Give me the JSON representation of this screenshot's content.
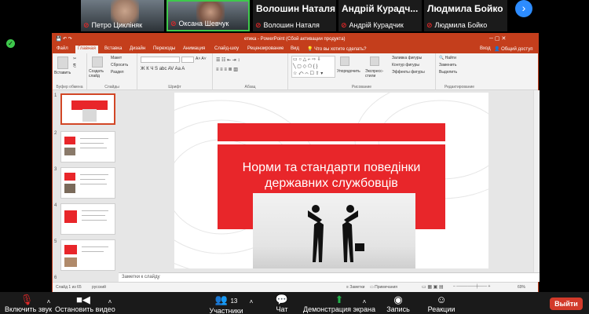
{
  "participants": [
    {
      "name": "Петро Цикліняк"
    },
    {
      "name": "Оксана Шевчук"
    },
    {
      "name": "Волошин Наталя",
      "caption": "Волошин Наталя"
    },
    {
      "name": "Андрій Курадч...",
      "caption": "Андрій Курадчик"
    },
    {
      "name": "Людмила Бойко",
      "caption": "Людмила Бойко"
    }
  ],
  "ppt": {
    "title": "етика - PowerPoint (Сбой активации продукта)",
    "search": "Что вы хотите сделать?",
    "account": "Вход",
    "share": "Общий доступ",
    "tabs": [
      "Файл",
      "Главная",
      "Вставка",
      "Дизайн",
      "Переходы",
      "Анимация",
      "Слайд-шоу",
      "Рецензирование",
      "Вид"
    ],
    "ribbon": {
      "paste": "Вставить",
      "clipboard": "Буфер обмена",
      "new_slide": "Создать слайд",
      "layout": "Макет",
      "reset": "Сбросить",
      "section": "Раздел",
      "slides": "Слайды",
      "font": "Шрифт",
      "paragraph": "Абзац",
      "arrange": "Упорядочить",
      "quick_styles": "Экспресс-стили",
      "fill": "Заливка фигуры",
      "outline": "Контур фигуры",
      "effects": "Эффекты фигуры",
      "drawing": "Рисование",
      "find": "Найти",
      "replace": "Заменить",
      "select": "Выделить",
      "editing": "Редактирование"
    },
    "slide": {
      "title": "Норми та стандарти поведінки державних службовців"
    },
    "thumb_numbers": [
      "1",
      "2",
      "3",
      "4",
      "5",
      "6"
    ],
    "notes_placeholder": "Заметки к слайду",
    "status": {
      "slide_info": "Слайд 1 из 65",
      "language": "русский",
      "notes": "Заметки",
      "comments": "Примечания",
      "zoom": "69%"
    }
  },
  "toolbar": {
    "mute": "Включить звук",
    "video": "Остановить видео",
    "participants": "Участники",
    "participants_count": "13",
    "chat": "Чат",
    "share": "Демонстрация экрана",
    "record": "Запись",
    "reactions": "Реакции",
    "leave": "Выйти"
  },
  "colors": {
    "accent": "#c43e1c",
    "slide_red": "#e8262a",
    "leave": "#d23a2a",
    "share_green": "#22b04a",
    "zoom_blue": "#2d8cff"
  }
}
